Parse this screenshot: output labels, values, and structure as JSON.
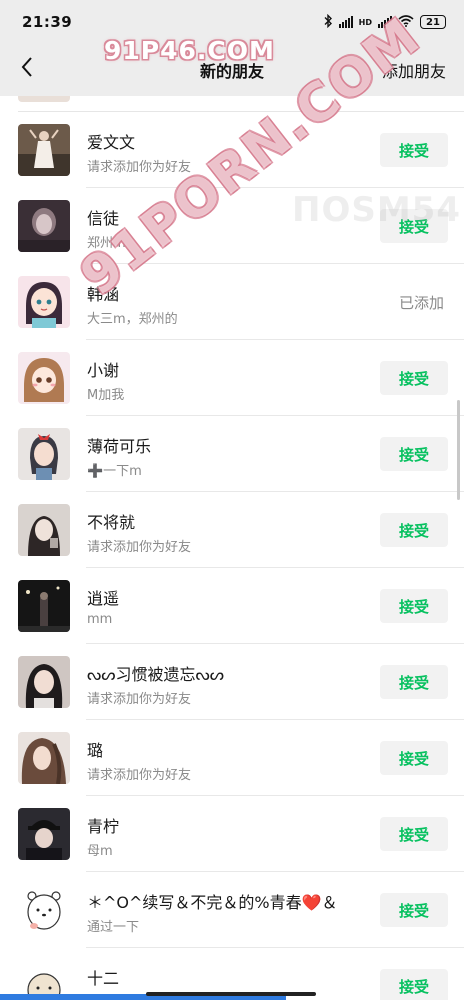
{
  "status_bar": {
    "time": "21:39",
    "network": "HD",
    "battery": "21"
  },
  "nav": {
    "title": "新的朋友",
    "action": "添加朋友"
  },
  "watermarks": {
    "top": "91P46.COM",
    "diagonal": "91PORN.COM",
    "faint": "ПОSM54"
  },
  "requests": [
    {
      "name": "爱文文",
      "message": "请求添加你为好友",
      "status": "pending",
      "action_label": "接受",
      "avatar": "photo-woman-white-dress"
    },
    {
      "name": "信徒",
      "message": "郑州m",
      "status": "pending",
      "action_label": "接受",
      "avatar": "photo-dark-portrait"
    },
    {
      "name": "韩涵",
      "message": "大三m，郑州的",
      "status": "added",
      "action_label": "已添加",
      "avatar": "anime-girl-teal-hair"
    },
    {
      "name": "小谢",
      "message": "M加我",
      "status": "pending",
      "action_label": "接受",
      "avatar": "anime-girl-brown-hair"
    },
    {
      "name": "薄荷可乐",
      "message": "➕一下m",
      "status": "pending",
      "action_label": "接受",
      "avatar": "cartoon-girl-red-bow"
    },
    {
      "name": "不将就",
      "message": "请求添加你为好友",
      "status": "pending",
      "action_label": "接受",
      "avatar": "photo-selfie-light"
    },
    {
      "name": "逍遥",
      "message": "mm",
      "status": "pending",
      "action_label": "接受",
      "avatar": "photo-night-street"
    },
    {
      "name": "ᔓᔕ习惯被遗忘ᔓᔕ",
      "message": "请求添加你为好友",
      "status": "pending",
      "action_label": "接受",
      "avatar": "photo-girl-dark-hair"
    },
    {
      "name": "璐",
      "message": "请求添加你为好友",
      "status": "pending",
      "action_label": "接受",
      "avatar": "photo-girl-long-hair"
    },
    {
      "name": "青柠",
      "message": "母m",
      "status": "pending",
      "action_label": "接受",
      "avatar": "photo-cap-selfie"
    },
    {
      "name": "＊^O^续写＆不完＆的%青春❤️＆",
      "message": "通过一下",
      "status": "pending",
      "action_label": "接受",
      "avatar": "cartoon-white-bear"
    },
    {
      "name": "十二",
      "message": "",
      "status": "pending",
      "action_label": "接受",
      "avatar": "cartoon-round-face"
    }
  ],
  "colors": {
    "accent": "#07c160",
    "header_bg": "#ededed",
    "button_bg": "#f2f2f2",
    "secondary_text": "#8a8a8a"
  }
}
